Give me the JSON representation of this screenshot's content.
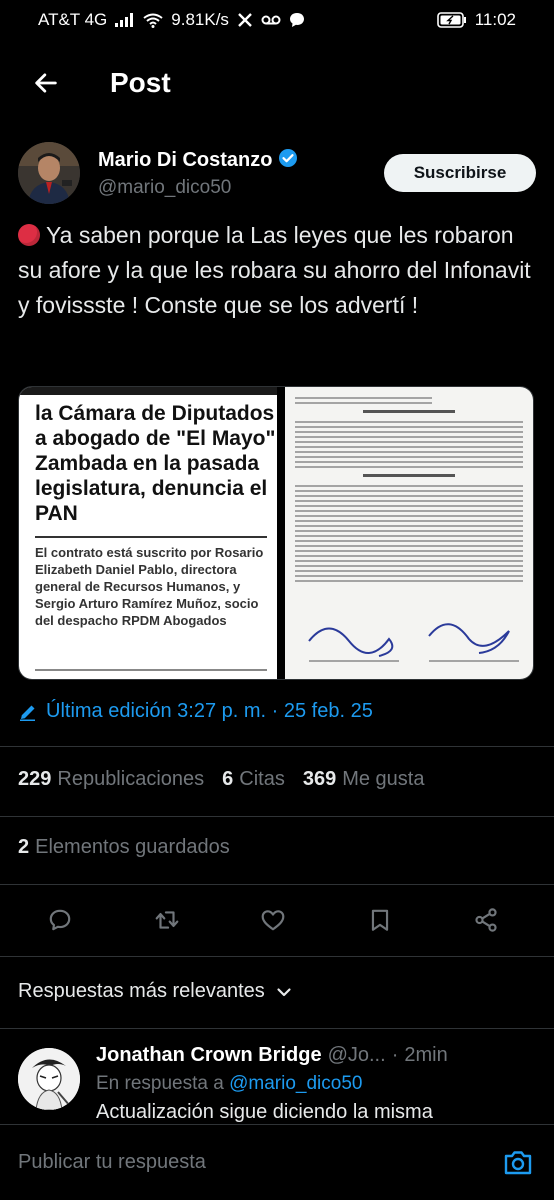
{
  "status_bar": {
    "carrier": "AT&T 4G",
    "speed": "9.81K/s",
    "time": "11:02",
    "icons": [
      "signal-icon",
      "wifi-icon",
      "x-app-icon",
      "voicemail-icon",
      "chat-icon",
      "battery-icon"
    ]
  },
  "header": {
    "title": "Post",
    "back_icon": "back-arrow-icon"
  },
  "author": {
    "name": "Mario Di Costanzo",
    "handle": "@mario_dico50",
    "verified": true,
    "subscribe_label": "Suscribirse"
  },
  "tweet": {
    "text": "Ya saben porque la Las leyes que les robaron su afore y la que les robara su ahorro del Infonavit y fovissste ! Conste que se los advertí !",
    "emoji": "red-circle"
  },
  "media": {
    "left_headline": "la Cámara de Diputados a abogado de \"El Mayo\" Zambada en la pasada legislatura, denuncia el PAN",
    "left_subtext": "El contrato está suscrito por Rosario Elizabeth Daniel Pablo, directora general de Recursos Humanos, y Sergio Arturo Ramírez Muñoz, socio del despacho RPDM Abogados"
  },
  "edited": {
    "label": "Última edición 3:27 p. m. · 25 feb. 25",
    "icon": "pencil-icon"
  },
  "stats": {
    "reposts_count": "229",
    "reposts_label": "Republicaciones",
    "quotes_count": "6",
    "quotes_label": "Citas",
    "likes_count": "369",
    "likes_label": "Me gusta",
    "bookmarks_count": "2",
    "bookmarks_label": "Elementos guardados"
  },
  "actions": [
    "reply-icon",
    "repost-icon",
    "like-icon",
    "bookmark-icon",
    "share-icon"
  ],
  "replies_sort": {
    "label": "Respuestas más relevantes"
  },
  "reply": {
    "name": "Jonathan Crown Bridge",
    "handle": "@Jo...",
    "time": "2min",
    "in_reply_prefix": "En respuesta a",
    "in_reply_mention": "@mario_dico50",
    "text": "Actualización sigue diciendo la misma"
  },
  "compose": {
    "placeholder": "Publicar tu respuesta"
  },
  "colors": {
    "background": "#000000",
    "text": "#e7e9ea",
    "muted": "#71767b",
    "accent": "#1d9bf0",
    "divider": "#2f3336"
  }
}
